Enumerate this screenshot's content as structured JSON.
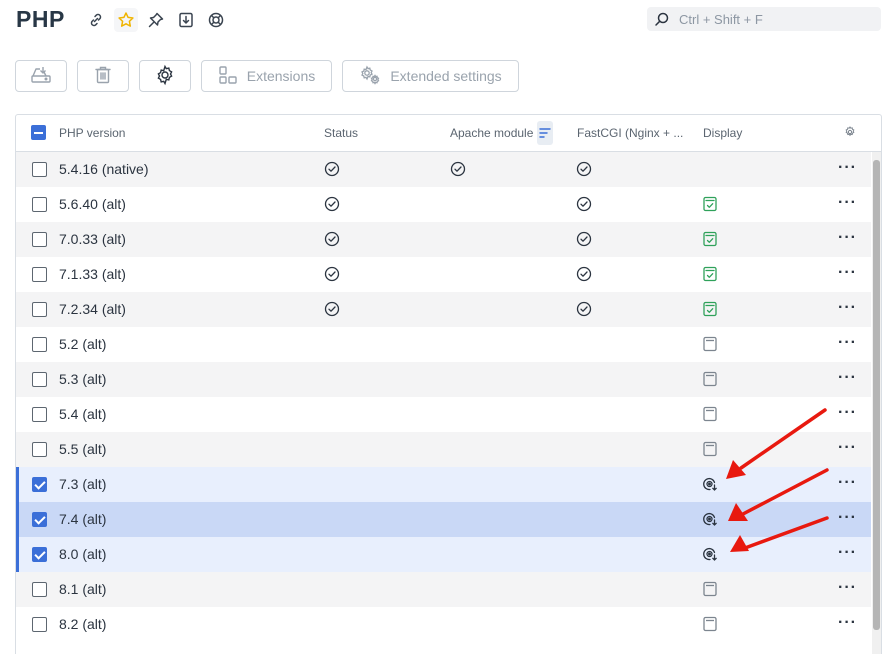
{
  "page": {
    "title": "PHP"
  },
  "search": {
    "placeholder": "Ctrl + Shift + F"
  },
  "toolbar": {
    "extensions_label": "Extensions",
    "extended_settings_label": "Extended settings"
  },
  "table": {
    "columns": {
      "version": "PHP version",
      "status": "Status",
      "apache": "Apache module",
      "fastcgi": "FastCGI (Nginx + ...",
      "display": "Display"
    },
    "rows": [
      {
        "version": "5.4.16 (native)",
        "checked": false,
        "status": true,
        "apache": true,
        "fastcgi": true,
        "display": "none"
      },
      {
        "version": "5.6.40 (alt)",
        "checked": false,
        "status": true,
        "apache": false,
        "fastcgi": true,
        "display": "on"
      },
      {
        "version": "7.0.33 (alt)",
        "checked": false,
        "status": true,
        "apache": false,
        "fastcgi": true,
        "display": "on"
      },
      {
        "version": "7.1.33 (alt)",
        "checked": false,
        "status": true,
        "apache": false,
        "fastcgi": true,
        "display": "on"
      },
      {
        "version": "7.2.34 (alt)",
        "checked": false,
        "status": true,
        "apache": false,
        "fastcgi": true,
        "display": "on"
      },
      {
        "version": "5.2 (alt)",
        "checked": false,
        "status": false,
        "apache": false,
        "fastcgi": false,
        "display": "off"
      },
      {
        "version": "5.3 (alt)",
        "checked": false,
        "status": false,
        "apache": false,
        "fastcgi": false,
        "display": "off"
      },
      {
        "version": "5.4 (alt)",
        "checked": false,
        "status": false,
        "apache": false,
        "fastcgi": false,
        "display": "off"
      },
      {
        "version": "5.5 (alt)",
        "checked": false,
        "status": false,
        "apache": false,
        "fastcgi": false,
        "display": "off"
      },
      {
        "version": "7.3 (alt)",
        "checked": true,
        "status": false,
        "apache": false,
        "fastcgi": false,
        "display": "installing"
      },
      {
        "version": "7.4 (alt)",
        "checked": true,
        "status": false,
        "apache": false,
        "fastcgi": false,
        "display": "installing"
      },
      {
        "version": "8.0 (alt)",
        "checked": true,
        "status": false,
        "apache": false,
        "fastcgi": false,
        "display": "installing"
      },
      {
        "version": "8.1 (alt)",
        "checked": false,
        "status": false,
        "apache": false,
        "fastcgi": false,
        "display": "off"
      },
      {
        "version": "8.2 (alt)",
        "checked": false,
        "status": false,
        "apache": false,
        "fastcgi": false,
        "display": "off"
      }
    ]
  },
  "colors": {
    "accent": "#3b6fd8",
    "display_on": "#2fa15a",
    "annotation_arrow": "#e8190f",
    "icon_gray": "#7c858f"
  },
  "icons": {
    "header": [
      "link-icon",
      "star-icon",
      "pin-icon",
      "import-icon",
      "lifebuoy-icon"
    ],
    "search": "search-icon",
    "toolbar": [
      "install-icon",
      "trash-icon",
      "gear-icon",
      "extensions-icon",
      "extended-settings-icon"
    ],
    "columns_settings": "gear-icon",
    "row_menu": "more-horizontal-icon"
  }
}
